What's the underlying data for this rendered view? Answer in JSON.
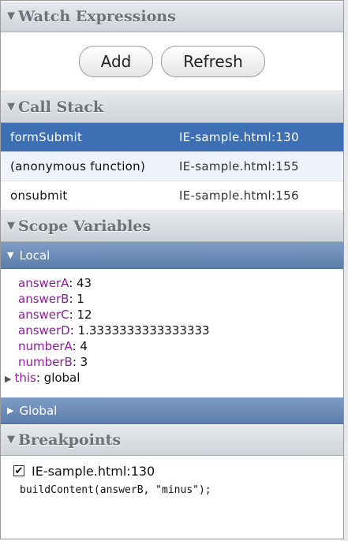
{
  "watch": {
    "title": "Watch Expressions",
    "add_label": "Add",
    "refresh_label": "Refresh"
  },
  "call_stack": {
    "title": "Call Stack",
    "rows": [
      {
        "fn": "formSubmit",
        "loc": "IE-sample.html:130",
        "selected": true
      },
      {
        "fn": "(anonymous function)",
        "loc": "IE-sample.html:155",
        "selected": false
      },
      {
        "fn": "onsubmit",
        "loc": "IE-sample.html:156",
        "selected": false
      }
    ]
  },
  "scope": {
    "title": "Scope Variables",
    "local_label": "Local",
    "global_label": "Global",
    "variables": [
      {
        "name": "answerA",
        "value": "43"
      },
      {
        "name": "answerB",
        "value": "1"
      },
      {
        "name": "answerC",
        "value": "12"
      },
      {
        "name": "answerD",
        "value": "1.3333333333333333"
      },
      {
        "name": "numberA",
        "value": "4"
      },
      {
        "name": "numberB",
        "value": "3"
      }
    ],
    "this_name": "this",
    "this_value": "global"
  },
  "breakpoints": {
    "title": "Breakpoints",
    "items": [
      {
        "label": "IE-sample.html:130",
        "checked": true,
        "code": "buildContent(answerB, \"minus\");"
      }
    ]
  },
  "colors": {
    "selection": "#3d6fb5",
    "variable_name": "#8a1f9a",
    "scope_bar": "#6b8bb8"
  },
  "icons": {
    "section_toggle": "triangle-down-icon",
    "scope_expanded": "triangle-down-icon",
    "scope_collapsed": "triangle-right-icon"
  }
}
